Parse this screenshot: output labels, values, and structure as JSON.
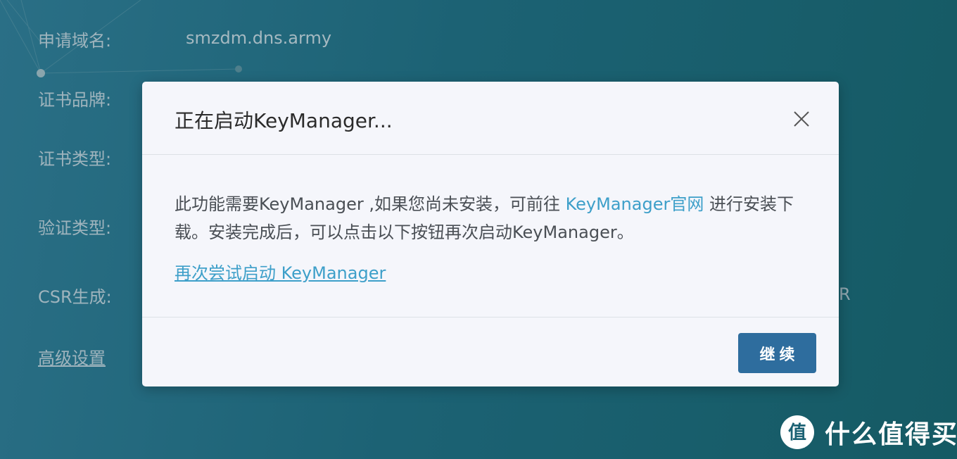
{
  "form": {
    "domain_label": "申请域名:",
    "domain_value": "smzdm.dns.army",
    "brand_label": "证书品牌:",
    "cert_type_label": "证书类型:",
    "verify_type_label": "验证类型:",
    "csr_label": "CSR生成:",
    "advanced_label": "高级设置",
    "clipped_text": "R"
  },
  "dialog": {
    "title": "正在启动KeyManager...",
    "body_part1": "此功能需要KeyManager ,如果您尚未安装，可前往 ",
    "official_site_link": "KeyManager官网",
    "body_part2": " 进行安装下载。安装完成后，可以点击以下按钮再次启动KeyManager。",
    "retry_link": "再次尝试启动 KeyManager",
    "continue_button": "继续"
  },
  "watermark": {
    "text": "什么值得买",
    "logo_char": "值"
  },
  "icons": {
    "close": "close-icon",
    "logo": "smzdm-logo-icon"
  },
  "colors": {
    "link": "#3d9fc9",
    "primary_button": "#2e6d9e",
    "background": "#1c6274"
  }
}
